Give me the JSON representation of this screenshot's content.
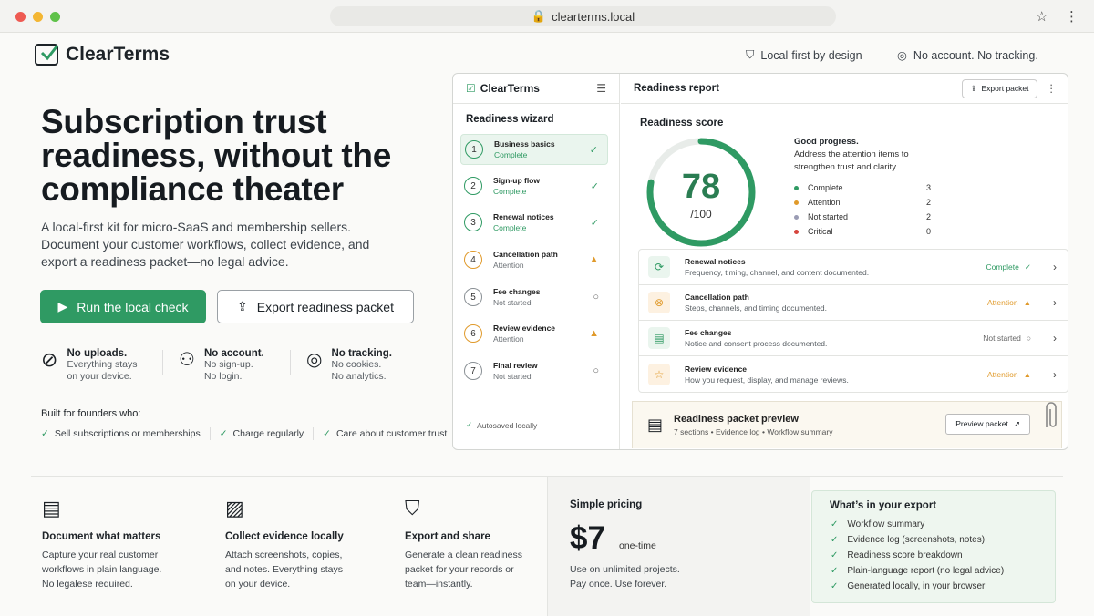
{
  "browser": {
    "url": "clearterms.local"
  },
  "header": {
    "brand": "ClearTerms",
    "badge1": "Local-first by design",
    "badge2": "No account. No tracking."
  },
  "hero": {
    "title": "Subscription trust readiness, without the compliance theater",
    "lead": "A local-first kit for micro-SaaS and membership sellers. Document your customer workflows, collect evidence, and export a readiness packet—no legal advice.",
    "cta_primary": "Run the local check",
    "cta_secondary": "Export readiness packet"
  },
  "features": [
    {
      "title": "No uploads.",
      "line1": "Everything stays",
      "line2": "on your device."
    },
    {
      "title": "No account.",
      "line1": "No sign-up.",
      "line2": "No login."
    },
    {
      "title": "No tracking.",
      "line1": "No cookies.",
      "line2": "No analytics."
    }
  ],
  "built": {
    "title": "Built for founders who:",
    "items": [
      "Sell subscriptions or memberships",
      "Charge regularly",
      "Care about customer trust"
    ]
  },
  "app": {
    "brand": "ClearTerms",
    "wizard_title": "Readiness wizard",
    "main_title": "Readiness report",
    "export_btn": "Export packet",
    "autosaved": "Autosaved locally",
    "steps": [
      {
        "n": "1",
        "label": "Business basics",
        "status": "Complete"
      },
      {
        "n": "2",
        "label": "Sign-up flow",
        "status": "Complete"
      },
      {
        "n": "3",
        "label": "Renewal notices",
        "status": "Complete"
      },
      {
        "n": "4",
        "label": "Cancellation path",
        "status": "Attention"
      },
      {
        "n": "5",
        "label": "Fee changes",
        "status": "Not started"
      },
      {
        "n": "6",
        "label": "Review evidence",
        "status": "Attention"
      },
      {
        "n": "7",
        "label": "Final review",
        "status": "Not started"
      }
    ],
    "score": {
      "title": "Readiness score",
      "value": "78",
      "max": "/100",
      "fraction": 0.78,
      "headline": "Good progress.",
      "desc1": "Address the attention items to",
      "desc2": "strengthen trust and clarity."
    },
    "legend": [
      {
        "label": "Complete",
        "count": "3",
        "color": "#2f9a63"
      },
      {
        "label": "Attention",
        "count": "2",
        "color": "#e09a2b"
      },
      {
        "label": "Not started",
        "count": "2",
        "color": "#9a9cb4"
      },
      {
        "label": "Critical",
        "count": "0",
        "color": "#d6453d"
      }
    ],
    "rows": [
      {
        "title": "Renewal notices",
        "desc": "Frequency, timing, channel, and content documented.",
        "status": "Complete"
      },
      {
        "title": "Cancellation path",
        "desc": "Steps, channels, and timing documented.",
        "status": "Attention"
      },
      {
        "title": "Fee changes",
        "desc": "Notice and consent process documented.",
        "status": "Not started"
      },
      {
        "title": "Review evidence",
        "desc": "How you request, display, and manage reviews.",
        "status": "Attention"
      }
    ],
    "preview": {
      "title": "Readiness packet preview",
      "sub": "7 sections • Evidence log • Workflow summary",
      "btn": "Preview packet"
    }
  },
  "bottom": {
    "cols": [
      {
        "title": "Document what matters",
        "lines": [
          "Capture your real customer",
          "workflows in plain language.",
          "No legalese required."
        ]
      },
      {
        "title": "Collect evidence locally",
        "lines": [
          "Attach screenshots, copies,",
          "and notes. Everything stays",
          "on your device."
        ]
      },
      {
        "title": "Export and share",
        "lines": [
          "Generate a clean readiness",
          "packet for your records or",
          "team—instantly."
        ]
      }
    ],
    "pricing": {
      "title": "Simple pricing",
      "price": "$7",
      "once": "one-time",
      "line1": "Use on unlimited projects.",
      "line2": "Pay once. Use forever."
    },
    "export": {
      "title": "What’s in your export",
      "items": [
        "Workflow summary",
        "Evidence log (screenshots, notes)",
        "Readiness score breakdown",
        "Plain-language report (no legal advice)",
        "Generated locally, in your browser"
      ]
    }
  }
}
